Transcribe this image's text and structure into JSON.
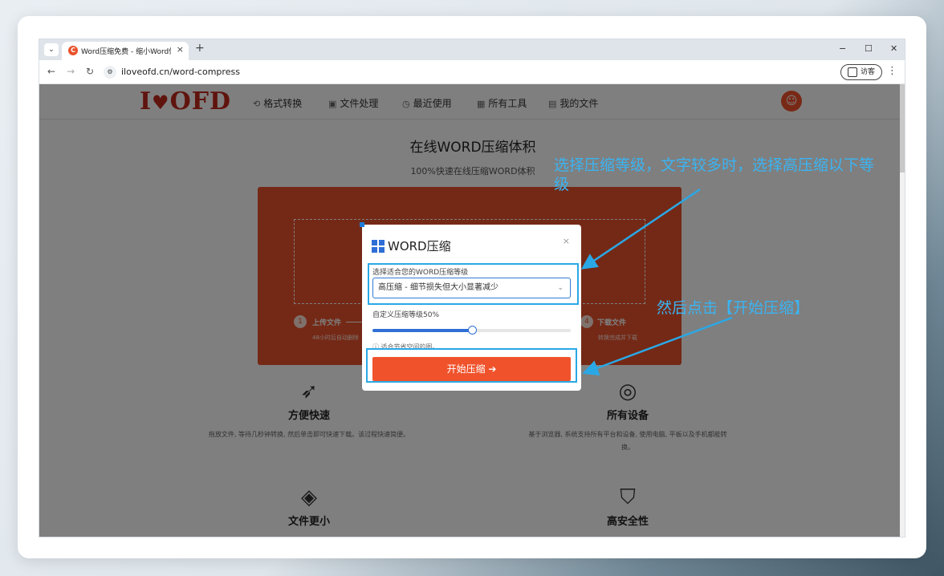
{
  "browser": {
    "tab_title": "Word压缩免费 - 缩小Word体积",
    "tab_close": "×",
    "new_tab": "+",
    "minimize": "−",
    "maximize": "☐",
    "close": "✕",
    "url": "iloveofd.cn/word-compress",
    "guest_label": "访客"
  },
  "site": {
    "logo_left": "I",
    "logo_right": "OFD",
    "nav": [
      {
        "icon": "format-convert-icon",
        "label": "格式转换"
      },
      {
        "icon": "file-process-icon",
        "label": "文件处理"
      },
      {
        "icon": "recent-icon",
        "label": "最近使用"
      },
      {
        "icon": "all-tools-icon",
        "label": "所有工具"
      },
      {
        "icon": "my-files-icon",
        "label": "我的文件"
      }
    ],
    "hero_title": "在线WORD压缩体积",
    "hero_subtitle": "100%快速在线压缩WORD体积",
    "steps": [
      {
        "num": "1",
        "label": "上传文件",
        "desc": "48小时后自动删除"
      },
      {
        "num": "4",
        "label": "下载文件",
        "desc": "转换完成并下载"
      }
    ],
    "features": [
      {
        "icon": "rocket-icon",
        "title": "方便快速",
        "desc": "拖放文件, 等待几秒钟转换, 然后单击即可快速下载。该过程快速简便。"
      },
      {
        "icon": "devices-icon",
        "title": "所有设备",
        "desc": "基于浏览器, 系统支持所有平台和设备, 使用电脑, 平板以及手机都能转换。"
      },
      {
        "icon": "layers-icon",
        "title": "文件更小",
        "desc": ""
      },
      {
        "icon": "shield-check-icon",
        "title": "高安全性",
        "desc": ""
      }
    ]
  },
  "modal": {
    "title": "WORD压缩",
    "close": "×",
    "level_label": "选择适合您的WORD压缩等级",
    "selected_level": "高压缩 - 细节损失但大小显著减少",
    "custom_label": "自定义压缩等级50%",
    "custom_percent": 50,
    "hint": "适合节省空间的图。",
    "start_button": "开始压缩 ➔"
  },
  "annotations": {
    "select_hint": "选择压缩等级，文字较多时，选择高压缩以下等级",
    "button_hint": "然后点击【开始压缩】",
    "color": "#2aa8e6"
  }
}
